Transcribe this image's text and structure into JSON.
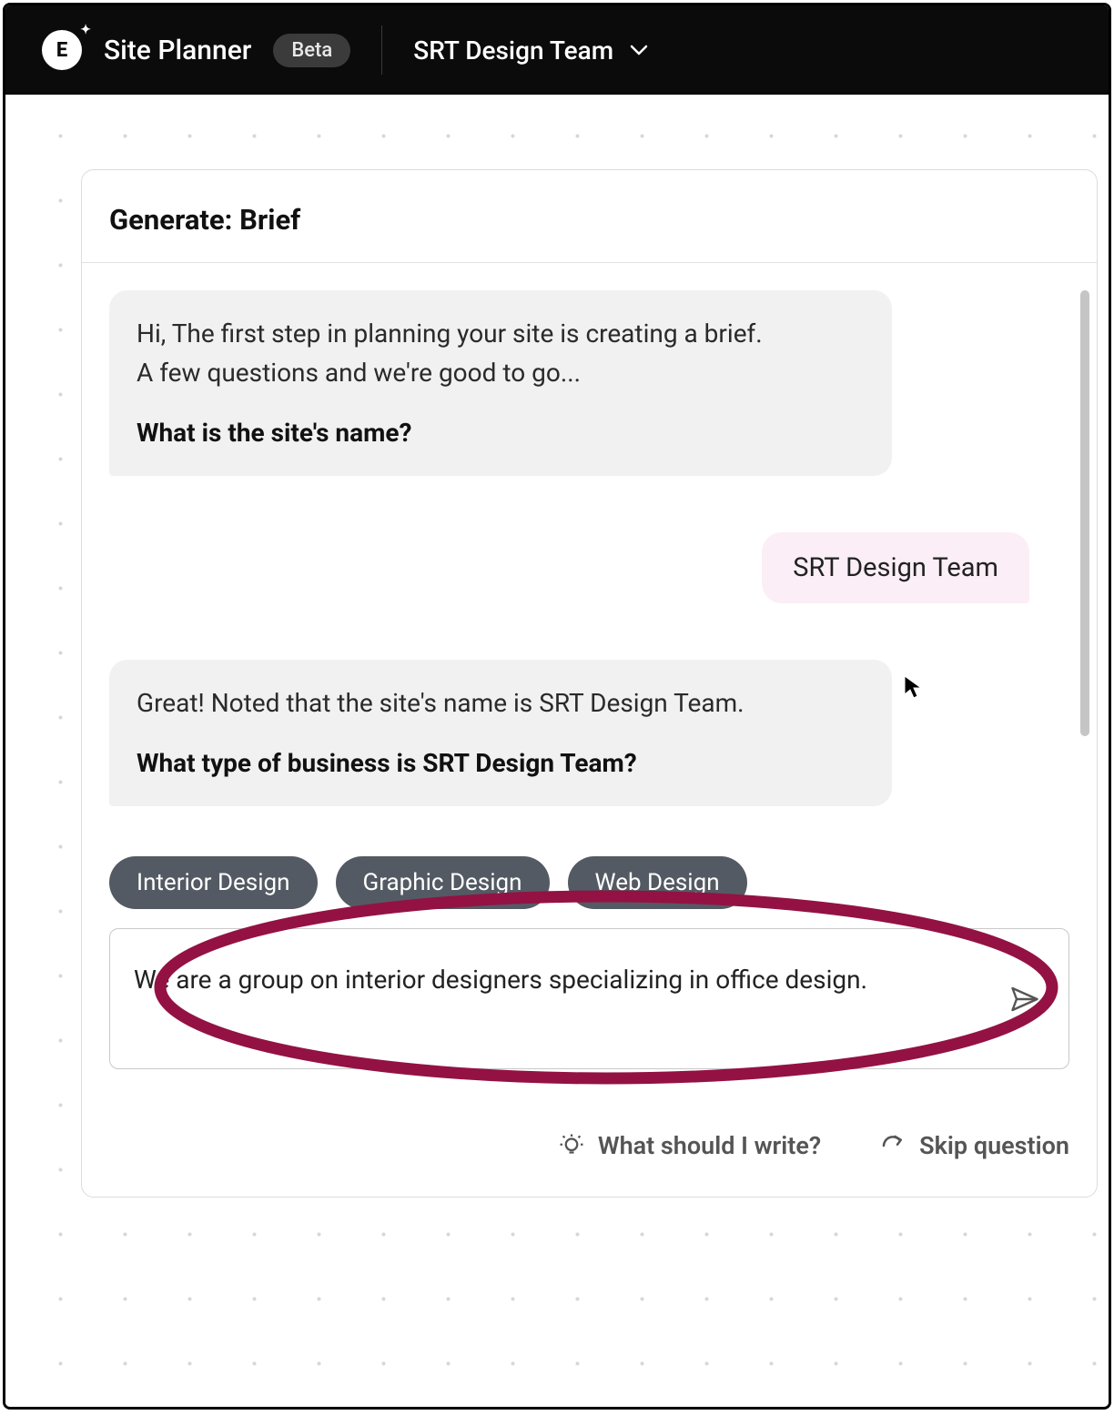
{
  "header": {
    "app_title": "Site Planner",
    "badge": "Beta",
    "team_name": "SRT Design Team"
  },
  "panel": {
    "title": "Generate: Brief"
  },
  "chat": {
    "m1_line1": "Hi, The first step in planning your site is creating a brief.",
    "m1_line2": "A few questions and we're good to go...",
    "m1_question": "What is the site's name?",
    "user1": "SRT Design Team",
    "m2_line1": "Great! Noted that the site's name is SRT Design Team.",
    "m2_question": "What type of business is SRT Design Team?"
  },
  "chips": {
    "c1": "Interior Design",
    "c2": "Graphic Design",
    "c3": "Web Design"
  },
  "input": {
    "value": "We are a group on interior designers specializing in office design."
  },
  "footer": {
    "suggest": "What should I write?",
    "skip": "Skip question"
  }
}
